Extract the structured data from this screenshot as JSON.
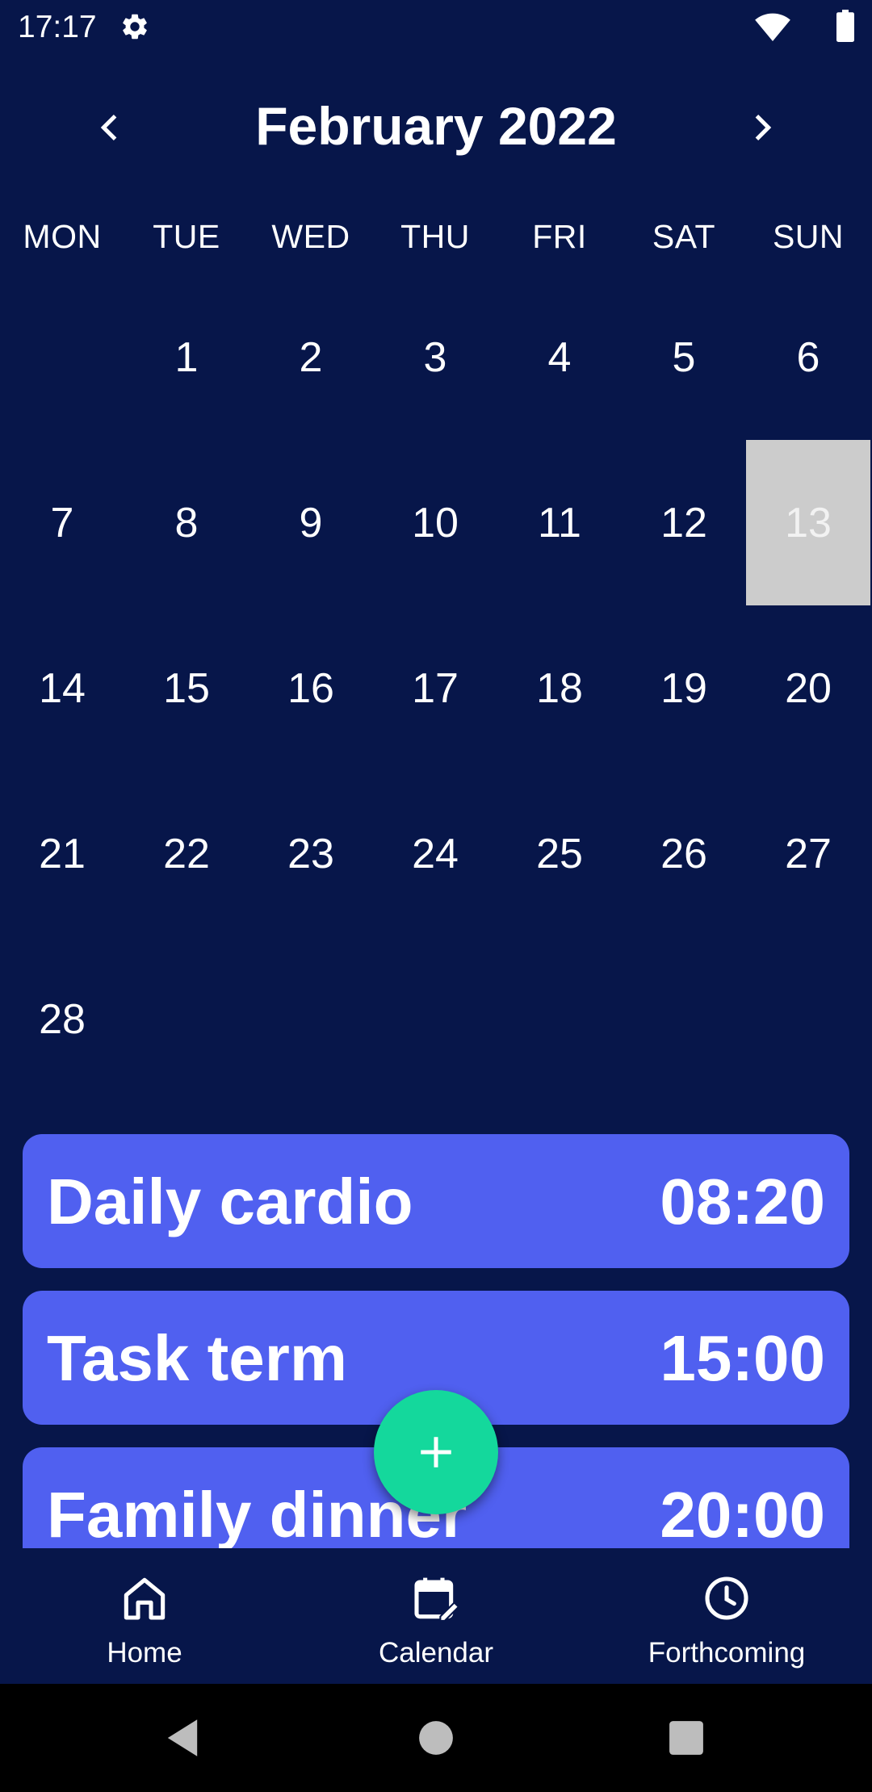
{
  "status_bar": {
    "time": "17:17",
    "icons": [
      "gear-icon",
      "wifi-icon",
      "battery-icon"
    ]
  },
  "calendar": {
    "month_title": "February 2022",
    "prev_icon": "chevron-left-icon",
    "next_icon": "chevron-right-icon",
    "weekdays": [
      "MON",
      "TUE",
      "WED",
      "THU",
      "FRI",
      "SAT",
      "SUN"
    ],
    "weeks": [
      [
        "",
        "1",
        "2",
        "3",
        "4",
        "5",
        "6"
      ],
      [
        "7",
        "8",
        "9",
        "10",
        "11",
        "12",
        "13"
      ],
      [
        "14",
        "15",
        "16",
        "17",
        "18",
        "19",
        "20"
      ],
      [
        "21",
        "22",
        "23",
        "24",
        "25",
        "26",
        "27"
      ],
      [
        "28",
        "",
        "",
        "",
        "",
        "",
        ""
      ]
    ],
    "selected_day": "13"
  },
  "events": [
    {
      "title": "Daily cardio",
      "time": "08:20"
    },
    {
      "title": "Task term",
      "time": "15:00"
    },
    {
      "title": "Family dinner",
      "time": "20:00"
    }
  ],
  "fab": {
    "icon": "plus-icon"
  },
  "bottom_nav": {
    "items": [
      {
        "label": "Home",
        "icon": "home-icon"
      },
      {
        "label": "Calendar",
        "icon": "calendar-edit-icon"
      },
      {
        "label": "Forthcoming",
        "icon": "clock-icon"
      }
    ]
  },
  "system_nav": {
    "icons": [
      "back-icon",
      "home-circle-icon",
      "recents-icon"
    ]
  },
  "colors": {
    "background": "#07164a",
    "event_card": "#5060f0",
    "fab": "#14d89c",
    "selected_day": "#cccccc"
  }
}
